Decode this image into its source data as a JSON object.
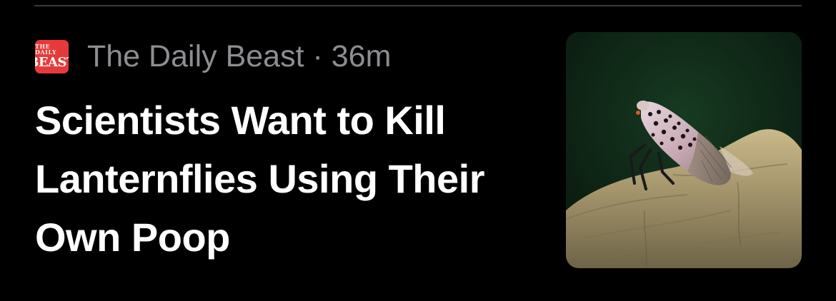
{
  "article": {
    "publisher": "The Daily Beast",
    "publisher_logo_text_top": "THE DAILY",
    "publisher_logo_text_main": "BEAST",
    "separator": " · ",
    "age": "36m",
    "headline": "Scientists Want to Kill Lanternflies Using Their Own Poop",
    "thumbnail_icon": "spotted-lanternfly-photo"
  },
  "colors": {
    "background": "#000000",
    "headline": "#ffffff",
    "meta": "#8d8d92",
    "publisher_logo": "#e63a3a",
    "divider": "#3a3a3c"
  }
}
